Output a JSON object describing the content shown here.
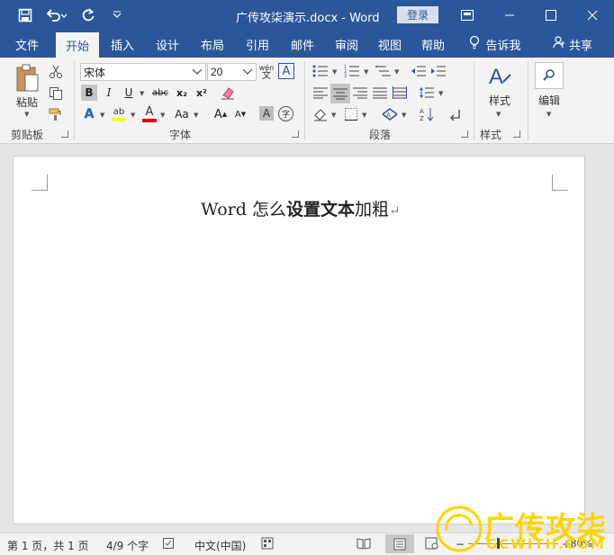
{
  "titlebar": {
    "doc_title": "广传攻柒演示.docx  -  Word",
    "login": "登录"
  },
  "tabs": [
    {
      "label": "文件"
    },
    {
      "label": "开始"
    },
    {
      "label": "插入"
    },
    {
      "label": "设计"
    },
    {
      "label": "布局"
    },
    {
      "label": "引用"
    },
    {
      "label": "邮件"
    },
    {
      "label": "审阅"
    },
    {
      "label": "视图"
    },
    {
      "label": "帮助"
    },
    {
      "label": "告诉我"
    },
    {
      "label": "共享"
    }
  ],
  "ribbon": {
    "clipboard": {
      "paste_label": "粘贴",
      "group_label": "剪贴板"
    },
    "font": {
      "font_name": "宋体",
      "font_size": "20",
      "group_label": "字体",
      "bold": "B",
      "italic": "I",
      "underline": "U",
      "strike": "abc",
      "subscript": "x₂",
      "superscript": "x²",
      "grow": "A",
      "shrink": "A",
      "case": "Aa",
      "wen": "wén",
      "wen_char": "文"
    },
    "paragraph": {
      "group_label": "段落"
    },
    "styles": {
      "label": "样式",
      "group_label": "样式"
    },
    "editing": {
      "label": "编辑"
    }
  },
  "document": {
    "text_prefix": "Word 怎么",
    "text_bold": "设置文本",
    "text_suffix": "加粗",
    "para_mark": "↵"
  },
  "statusbar": {
    "page": "第 1 页，共 1 页",
    "words": "4/9 个字",
    "lang": "中文(中国)",
    "zoom": "80%"
  },
  "watermark": {
    "text": "广传攻柒",
    "sub": "GCWITH.COM"
  },
  "colors": {
    "brand": "#2b579a",
    "highlight": "#ffff00",
    "font_color": "#e00000",
    "watermark": "#ffd400"
  }
}
